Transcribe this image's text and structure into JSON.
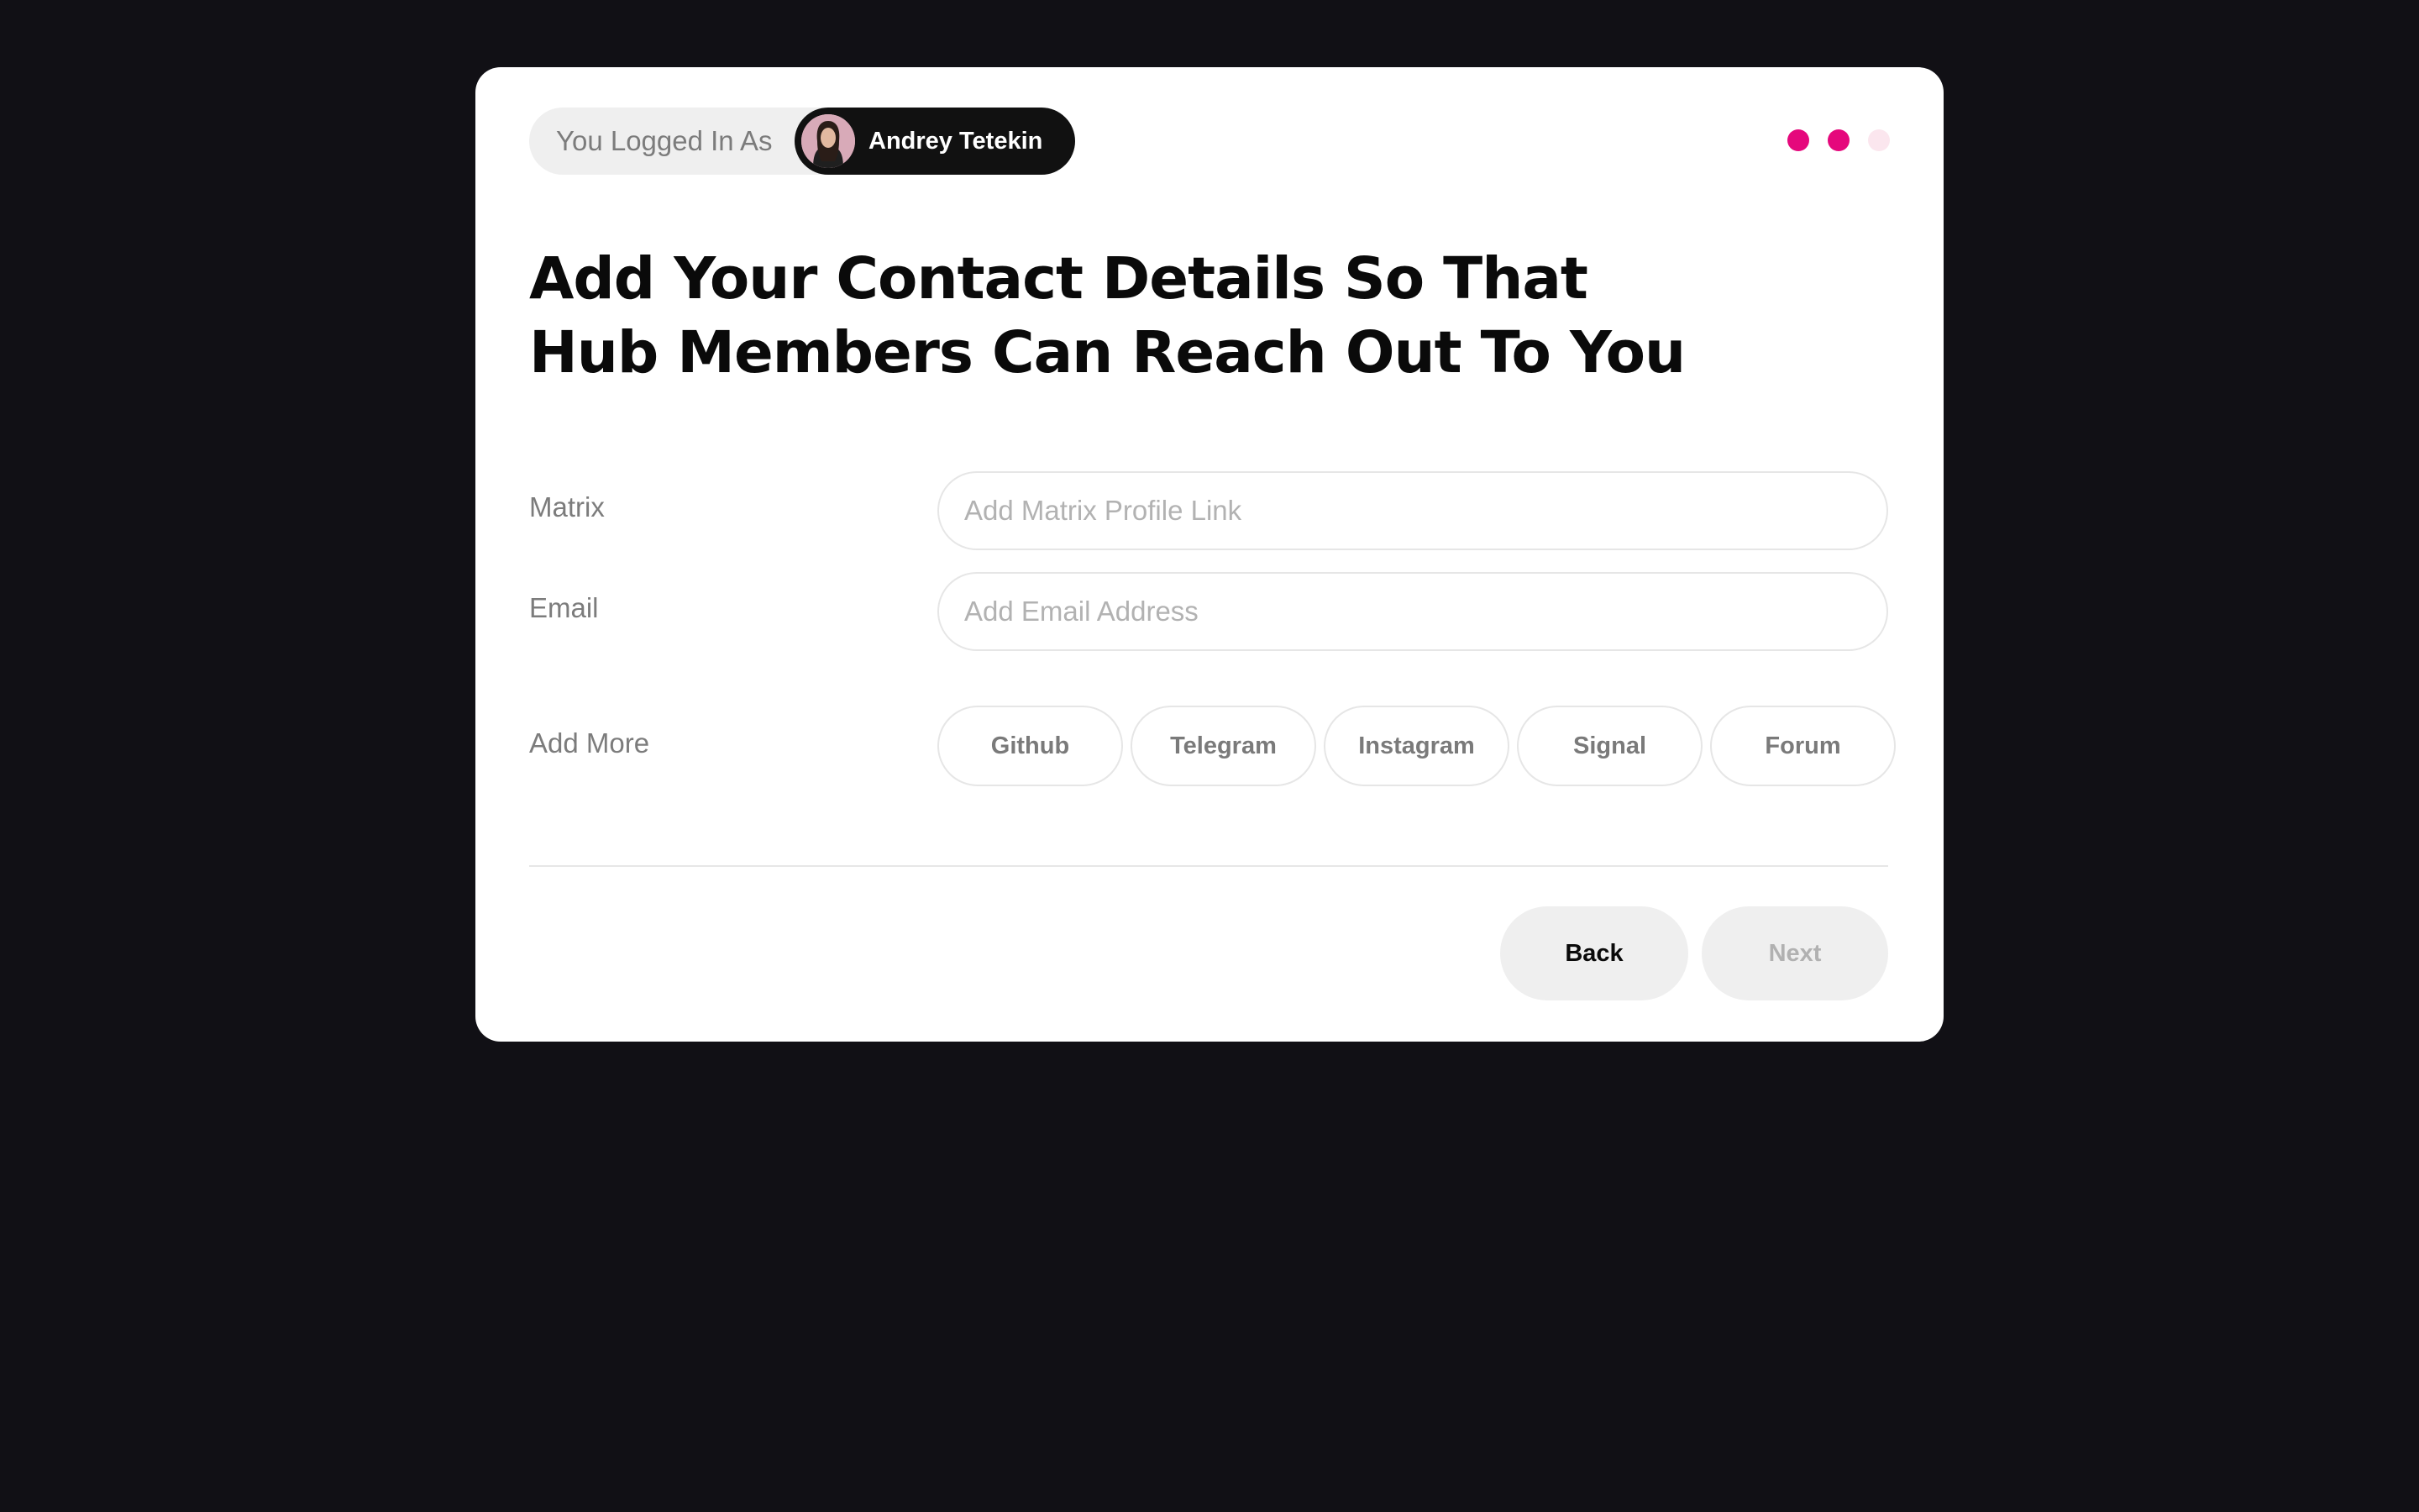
{
  "header": {
    "login_label": "You Logged In As",
    "user_name": "Andrey Tetekin",
    "progress": {
      "steps": [
        {
          "state": "done",
          "color": "#e5087c"
        },
        {
          "state": "current",
          "color": "#e5087c"
        },
        {
          "state": "upcoming",
          "color": "#fbe6ee"
        }
      ]
    }
  },
  "title": {
    "line1": "Add Your Contact Details So That",
    "line2": "Hub Members Can Reach Out To You"
  },
  "form": {
    "matrix": {
      "label": "Matrix",
      "placeholder": "Add Matrix Profile Link",
      "value": ""
    },
    "email": {
      "label": "Email",
      "placeholder": "Add Email Address",
      "value": ""
    },
    "add_more": {
      "label": "Add More",
      "options": [
        "Github",
        "Telegram",
        "Instagram",
        "Signal",
        "Forum"
      ]
    }
  },
  "footer": {
    "back_label": "Back",
    "next_label": "Next"
  },
  "colors": {
    "background": "#111015",
    "card": "#ffffff",
    "accent": "#e5087c",
    "user_pill": "#111111"
  }
}
